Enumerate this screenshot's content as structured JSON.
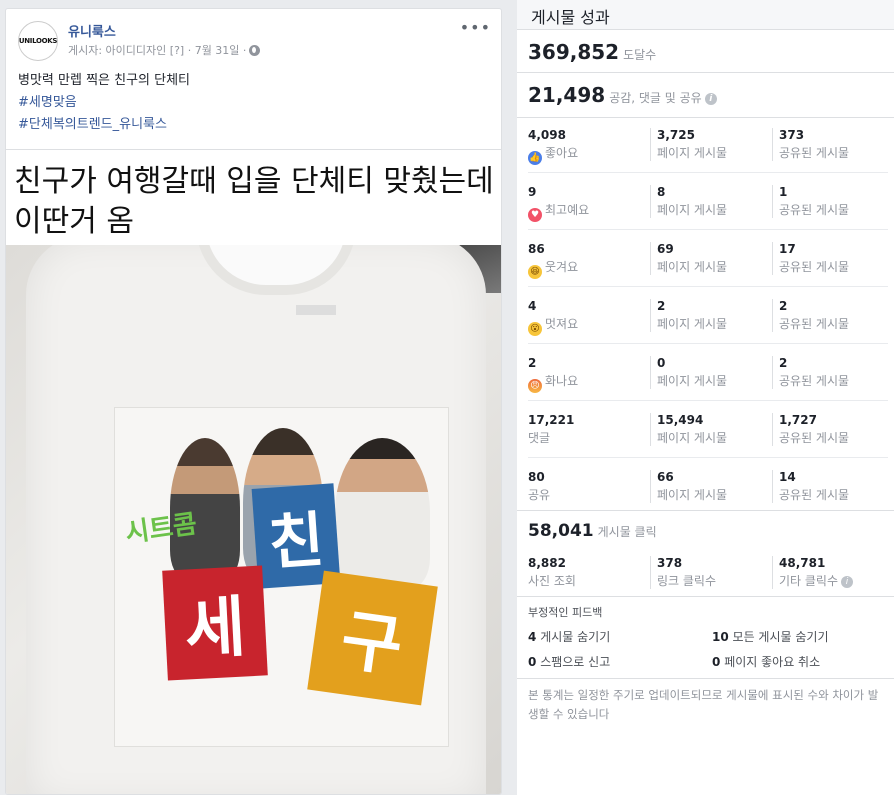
{
  "post": {
    "page_name": "유니룩스",
    "avatar_text": "UNILOOKS",
    "meta": "게시자: 아이디디자인 [?] · 7월 31일 ·",
    "text_line1": "병맛력 만렙 찍은 친구의 단체티",
    "hashtag1": "#세명맞음",
    "hashtag2": "#단체복의트렌드_유니룩스",
    "headline": "친구가 여행갈때 입을 단체티 맞췄는데 이딴거 옴",
    "print_small": "시트콤",
    "print_blue": "친",
    "print_red": "세",
    "print_yellow": "구"
  },
  "panel": {
    "title": "게시물 성과",
    "reach_value": "369,852",
    "reach_label": "도달수",
    "engagement_value": "21,498",
    "engagement_label": "공감, 댓글 및 공유",
    "rows": [
      {
        "icon": "like-icon",
        "c1_num": "4,098",
        "c1_lbl": "좋아요",
        "c2_num": "3,725",
        "c2_lbl": "페이지 게시물",
        "c3_num": "373",
        "c3_lbl": "공유된 게시물"
      },
      {
        "icon": "love-icon",
        "c1_num": "9",
        "c1_lbl": "최고예요",
        "c2_num": "8",
        "c2_lbl": "페이지 게시물",
        "c3_num": "1",
        "c3_lbl": "공유된 게시물"
      },
      {
        "icon": "haha-icon",
        "c1_num": "86",
        "c1_lbl": "웃겨요",
        "c2_num": "69",
        "c2_lbl": "페이지 게시물",
        "c3_num": "17",
        "c3_lbl": "공유된 게시물"
      },
      {
        "icon": "wow-icon",
        "c1_num": "4",
        "c1_lbl": "멋져요",
        "c2_num": "2",
        "c2_lbl": "페이지 게시물",
        "c3_num": "2",
        "c3_lbl": "공유된 게시물"
      },
      {
        "icon": "angry-icon",
        "c1_num": "2",
        "c1_lbl": "화나요",
        "c2_num": "0",
        "c2_lbl": "페이지 게시물",
        "c3_num": "2",
        "c3_lbl": "공유된 게시물"
      },
      {
        "icon": "",
        "c1_num": "17,221",
        "c1_lbl": "댓글",
        "c2_num": "15,494",
        "c2_lbl": "페이지 게시물",
        "c3_num": "1,727",
        "c3_lbl": "공유된 게시물"
      },
      {
        "icon": "",
        "c1_num": "80",
        "c1_lbl": "공유",
        "c2_num": "66",
        "c2_lbl": "페이지 게시물",
        "c3_num": "14",
        "c3_lbl": "공유된 게시물"
      }
    ],
    "clicks_value": "58,041",
    "clicks_label": "게시물 클릭",
    "click_cells": [
      {
        "num": "8,882",
        "lbl": "사진 조회"
      },
      {
        "num": "378",
        "lbl": "링크 클릭수"
      },
      {
        "num": "48,781",
        "lbl": "기타 클릭수"
      }
    ],
    "negative_title": "부정적인 피드백",
    "negative": [
      {
        "num": "4",
        "lbl": "게시물 숨기기"
      },
      {
        "num": "10",
        "lbl": "모든 게시물 숨기기"
      },
      {
        "num": "0",
        "lbl": "스팸으로 신고"
      },
      {
        "num": "0",
        "lbl": "페이지 좋아요 취소"
      }
    ],
    "note": "본 통계는 일정한 주기로 업데이트되므로 게시물에 표시된 수와 차이가 발생할 수 있습니다"
  }
}
